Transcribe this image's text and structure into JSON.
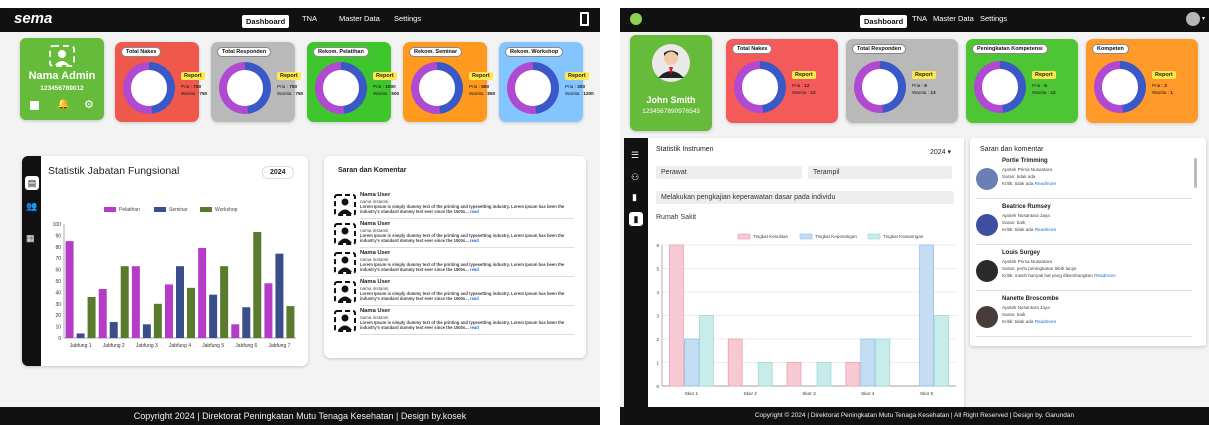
{
  "left": {
    "logo": "sema",
    "nav": [
      "Dashboard",
      "TNA",
      "Master Data",
      "Settings"
    ],
    "profile": {
      "name": "Nama Admin",
      "id": "123456789012"
    },
    "summary_cards": [
      {
        "title": "Total Nakes",
        "color": "#f0584c",
        "report": "Report",
        "pria_label": "Pria",
        "pria": "750",
        "wanita_label": "Wanita",
        "wanita": "750"
      },
      {
        "title": "Total Responden",
        "color": "#b9b9b9",
        "report": "Report",
        "pria_label": "Pria",
        "pria": "750",
        "wanita_label": "Wanita",
        "wanita": "750"
      },
      {
        "title": "Rekom. Pelatihan",
        "color": "#3fc62c",
        "report": "Report",
        "pria_label": "Pria",
        "pria": "1000",
        "wanita_label": "Wanita",
        "wanita": "500"
      },
      {
        "title": "Rekom. Seminar",
        "color": "#ff9a1e",
        "report": "Report",
        "pria_label": "Pria",
        "pria": "650",
        "wanita_label": "Wanita",
        "wanita": "850"
      },
      {
        "title": "Rekom. Workshop",
        "color": "#84c4ff",
        "report": "Report",
        "pria_label": "Pria",
        "pria": "300",
        "wanita_label": "Wanita",
        "wanita": "1200"
      }
    ],
    "stat_title": "Statistik Jabatan Fungsional",
    "year": "2024",
    "comments_title": "Saran dan Komentar",
    "comments": [
      {
        "name": "Nama User",
        "instansi": "nama instansi",
        "text": "Lorem Ipsum is simply dummy text of the printing and typesetting industry. Lorem Ipsum has been the industry's standard dummy text ever since the 1500s...",
        "more": "read"
      },
      {
        "name": "Nama User",
        "instansi": "nama instansi",
        "text": "Lorem Ipsum is simply dummy text of the printing and typesetting industry. Lorem Ipsum has been the industry's standard dummy text ever since the 1500s...",
        "more": "read"
      },
      {
        "name": "Nama User",
        "instansi": "nama instansi",
        "text": "Lorem Ipsum is simply dummy text of the printing and typesetting industry. Lorem Ipsum has been the industry's standard dummy text ever since the 1500s...",
        "more": "read"
      },
      {
        "name": "Nama User",
        "instansi": "nama instansi",
        "text": "Lorem Ipsum is simply dummy text of the printing and typesetting industry. Lorem Ipsum has been the industry's standard dummy text ever since the 1500s...",
        "more": "read"
      },
      {
        "name": "Nama User",
        "instansi": "nama instansi",
        "text": "Lorem Ipsum is simply dummy text of the printing and typesetting industry. Lorem Ipsum has been the industry's standard dummy text ever since the 1500s...",
        "more": "read"
      }
    ],
    "footer": "Copyright 2024 | Direktorat Peningkatan Mutu Tenaga Kesehatan | Design by.kosek"
  },
  "right": {
    "nav": [
      "Dashboard",
      "TNA",
      "Master Data",
      "Settings"
    ],
    "profile": {
      "name": "John Smith",
      "id": "1234567890976543"
    },
    "summary_cards": [
      {
        "title": "Total Nakes",
        "color": "#f55a5a",
        "report": "Report",
        "pria_label": "Pria",
        "pria": "12",
        "wanita_label": "Wanita",
        "wanita": "12"
      },
      {
        "title": "Total Responden",
        "color": "#b9b9b9",
        "report": "Report",
        "pria_label": "Pria",
        "pria": "9",
        "wanita_label": "Wanita",
        "wanita": "13"
      },
      {
        "title": "Peningkatan Kompetensi",
        "color": "#4ec534",
        "report": "Report",
        "pria_label": "Pria",
        "pria": "6",
        "wanita_label": "Wanita",
        "wanita": "12"
      },
      {
        "title": "Kompeten",
        "color": "#ff9a2a",
        "report": "Report",
        "pria_label": "Pria",
        "pria": "3",
        "wanita_label": "Wanita",
        "wanita": "1"
      }
    ],
    "stat_title": "Statistik Instrumen",
    "year": "2024",
    "select1": "Perawat",
    "select2": "Terampil",
    "select3": "Melakukan pengkajian keperawatan dasar pada individu",
    "facility": "Rumah Sakit",
    "comments_title": "Saran dan komentar",
    "comments": [
      {
        "name": "Portie Trimming",
        "instansi": "Apotek Prima Nusantara",
        "saran": "Saran: tidak ada",
        "kritik": "Kritik: tidak ada",
        "more": "Readmore"
      },
      {
        "name": "Beatrice Rumsey",
        "instansi": "Apotek Nusantara Jaya",
        "saran": "Saran: baik",
        "kritik": "Kritik: tidak ada",
        "more": "Readmore"
      },
      {
        "name": "Louis Surgey",
        "instansi": "Apotek Prima Nusantara",
        "saran": "Saran: perlu peningkatan lebih lanjut",
        "kritik": "Kritik: masih banyak hal yang dikembangkan",
        "more": "Readmore"
      },
      {
        "name": "Nanette Broscombe",
        "instansi": "Apotek Nusantara Jaya",
        "saran": "Saran: baik",
        "kritik": "Kritik: tidak ada",
        "more": "Readmore"
      }
    ],
    "footer": "Copyright © 2024 | Direktorat Peningkatan Mutu Tenaga Kesehatan | All Right Reserved | Design by. Garundan"
  },
  "chart_data": [
    {
      "type": "bar",
      "categories": [
        "Jabfung 1",
        "Jabfung 2",
        "Jabfung 3",
        "Jabfung 4",
        "Jabfung 5",
        "Jabfung 6",
        "Jabfung 7"
      ],
      "series": [
        {
          "name": "Pelatihan",
          "color": "#b43cc6",
          "values": [
            85,
            43,
            63,
            47,
            79,
            12,
            48
          ]
        },
        {
          "name": "Seminar",
          "color": "#3a4f8a",
          "values": [
            4,
            14,
            12,
            63,
            38,
            27,
            74
          ]
        },
        {
          "name": "Workshop",
          "color": "#5a7a2e",
          "values": [
            36,
            63,
            30,
            44,
            63,
            93,
            28
          ]
        }
      ],
      "ylim": [
        0,
        100
      ],
      "yticks": [
        100,
        90,
        80,
        70,
        60,
        50,
        40,
        30,
        20,
        10,
        0
      ],
      "legend": "top",
      "grid": false
    },
    {
      "type": "bar",
      "categories": [
        "Skor 1",
        "Skor 2",
        "Skor 3",
        "Skor 4",
        "Skor 5"
      ],
      "series": [
        {
          "name": "Tingkat Kesulitan",
          "color": "#f7c9d3",
          "values": [
            6,
            2,
            1,
            1,
            0
          ]
        },
        {
          "name": "Tingkat Kepentingan",
          "color": "#c4ddf3",
          "values": [
            2,
            0,
            0,
            2,
            6
          ]
        },
        {
          "name": "Tingkat Kewaringan",
          "color": "#c7ecea",
          "values": [
            3,
            1,
            1,
            2,
            3
          ]
        }
      ],
      "ylim": [
        0,
        6
      ],
      "yticks": [
        6,
        5,
        4,
        3,
        2,
        1,
        0
      ],
      "legend": "top",
      "grid": true
    }
  ]
}
